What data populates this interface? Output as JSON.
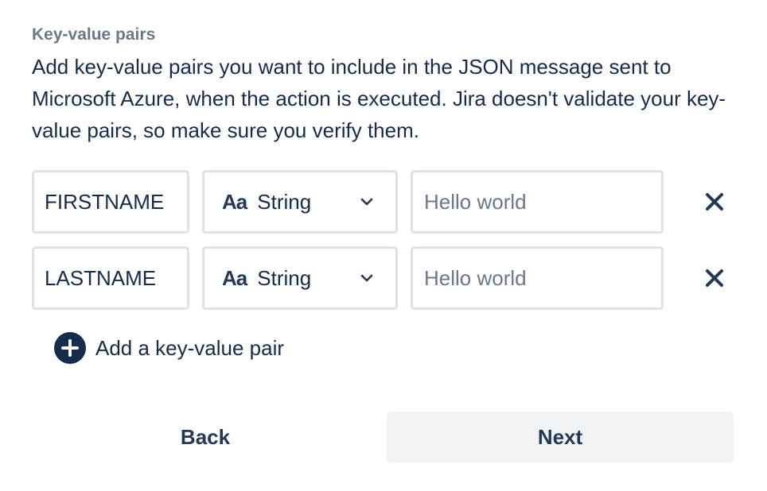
{
  "section": {
    "label": "Key-value pairs",
    "description": "Add key-value pairs you want to include in the JSON message sent to Microsoft Azure, when the action is executed. Jira doesn't validate your key-value pairs, so make sure you verify them."
  },
  "pairs": [
    {
      "key": "FIRSTNAME",
      "type_glyph": "Aa",
      "type_label": "String",
      "value_placeholder": "Hello world"
    },
    {
      "key": "LASTNAME",
      "type_glyph": "Aa",
      "type_label": "String",
      "value_placeholder": "Hello world"
    }
  ],
  "add_pair": {
    "label": "Add a key-value pair",
    "icon": "plus-circle-icon"
  },
  "buttons": {
    "back_label": "Back",
    "next_label": "Next"
  },
  "icons": {
    "type_dropdown": "chevron-down-icon",
    "remove": "close-icon"
  },
  "colors": {
    "text_primary": "#172B4D",
    "text_subtle": "#6B778C",
    "border": "#DFE1E6",
    "button_subtle_bg": "#F1F2F4",
    "icon_dark": "#253858"
  }
}
